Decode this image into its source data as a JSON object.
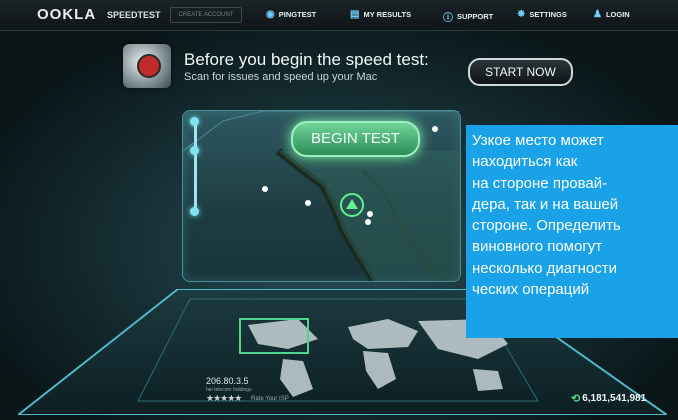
{
  "topbar": {
    "logo": "OOKLA",
    "logo_sub": "SPEEDTEST",
    "create_account": "CREATE ACCOUNT",
    "nav": [
      {
        "label": "PINGTEST",
        "icon": "globe-icon"
      },
      {
        "label": "MY RESULTS",
        "icon": "results-icon"
      },
      {
        "label": "SUPPORT",
        "icon": "support-icon"
      },
      {
        "label": "SETTINGS",
        "icon": "gear-icon"
      },
      {
        "label": "LOGIN",
        "icon": "user-icon"
      }
    ]
  },
  "promo": {
    "title": "Before you begin the speed test:",
    "subtitle": "Scan for issues and speed up your Mac",
    "button": "START NOW"
  },
  "speedtest": {
    "begin_button": "BEGIN TEST",
    "ip": "206.80.3.5",
    "isp": "hei telecom holdings",
    "stars": "★★★★★",
    "rate_label": "Rate Your ISP",
    "test_count": "6,181,541,981"
  },
  "caption": {
    "lines": [
      "Узкое место может",
      "находиться как",
      "на стороне провай-",
      "дера, так и на вашей",
      "стороне. Определить",
      "виновного помогут",
      "несколько диагности",
      "ческих операций"
    ]
  },
  "colors": {
    "caption_bg": "#1aa2e8",
    "begin_button": "#5cc98b",
    "accent": "#7fe3f0"
  }
}
